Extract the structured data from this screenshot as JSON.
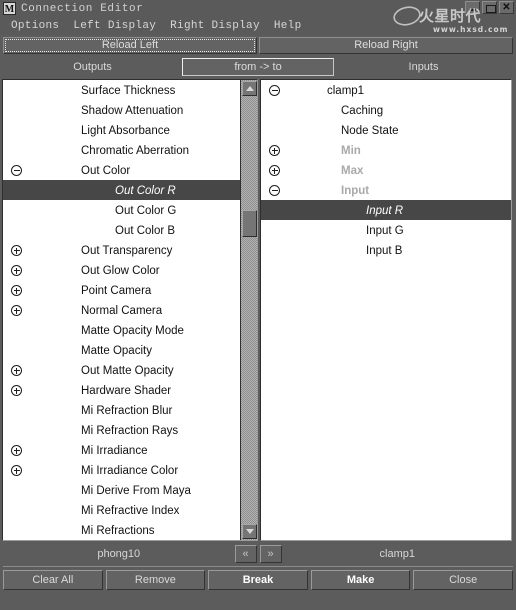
{
  "window": {
    "title": "Connection Editor",
    "icon": "maya-m-icon",
    "controls": {
      "minimize": "minimize-icon",
      "maximize": "maximize-icon",
      "close": "✕"
    }
  },
  "watermark": {
    "url_text": "www.hxsd.com",
    "brand": "火星时代"
  },
  "menubar": {
    "items": [
      {
        "label": "Options"
      },
      {
        "label": "Left Display"
      },
      {
        "label": "Right Display"
      },
      {
        "label": "Help"
      }
    ]
  },
  "reload": {
    "left_label": "Reload Left",
    "right_label": "Reload Right"
  },
  "tabs": {
    "outputs_label": "Outputs",
    "middle_label": "from -> to",
    "inputs_label": "Inputs"
  },
  "left_panel": {
    "node_name": "phong10",
    "rows": [
      {
        "label": "Surface Thickness",
        "indent": 0,
        "toggle": "none",
        "state": "normal"
      },
      {
        "label": "Shadow Attenuation",
        "indent": 0,
        "toggle": "none",
        "state": "normal"
      },
      {
        "label": "Light Absorbance",
        "indent": 0,
        "toggle": "none",
        "state": "normal"
      },
      {
        "label": "Chromatic Aberration",
        "indent": 0,
        "toggle": "none",
        "state": "normal"
      },
      {
        "label": "Out Color",
        "indent": 0,
        "toggle": "minus",
        "state": "normal"
      },
      {
        "label": "Out Color R",
        "indent": 1,
        "toggle": "none",
        "state": "selected"
      },
      {
        "label": "Out Color G",
        "indent": 1,
        "toggle": "none",
        "state": "normal"
      },
      {
        "label": "Out Color B",
        "indent": 1,
        "toggle": "none",
        "state": "normal"
      },
      {
        "label": "Out Transparency",
        "indent": 0,
        "toggle": "plus",
        "state": "normal"
      },
      {
        "label": "Out Glow Color",
        "indent": 0,
        "toggle": "plus",
        "state": "normal"
      },
      {
        "label": "Point Camera",
        "indent": 0,
        "toggle": "plus",
        "state": "normal"
      },
      {
        "label": "Normal Camera",
        "indent": 0,
        "toggle": "plus",
        "state": "normal"
      },
      {
        "label": "Matte Opacity Mode",
        "indent": 0,
        "toggle": "none",
        "state": "normal"
      },
      {
        "label": "Matte Opacity",
        "indent": 0,
        "toggle": "none",
        "state": "normal"
      },
      {
        "label": "Out Matte Opacity",
        "indent": 0,
        "toggle": "plus",
        "state": "normal"
      },
      {
        "label": "Hardware Shader",
        "indent": 0,
        "toggle": "plus",
        "state": "normal"
      },
      {
        "label": "Mi Refraction Blur",
        "indent": 0,
        "toggle": "none",
        "state": "normal"
      },
      {
        "label": "Mi Refraction Rays",
        "indent": 0,
        "toggle": "none",
        "state": "normal"
      },
      {
        "label": "Mi Irradiance",
        "indent": 0,
        "toggle": "plus",
        "state": "normal"
      },
      {
        "label": "Mi Irradiance Color",
        "indent": 0,
        "toggle": "plus",
        "state": "normal"
      },
      {
        "label": "Mi Derive From Maya",
        "indent": 0,
        "toggle": "none",
        "state": "normal"
      },
      {
        "label": "Mi Refractive Index",
        "indent": 0,
        "toggle": "none",
        "state": "normal"
      },
      {
        "label": "Mi Refractions",
        "indent": 0,
        "toggle": "none",
        "state": "normal"
      }
    ]
  },
  "right_panel": {
    "node_name": "clamp1",
    "rows": [
      {
        "label": "clamp1",
        "indent": 0,
        "toggle": "minus",
        "state": "normal"
      },
      {
        "label": "Caching",
        "indent": 1,
        "toggle": "none",
        "state": "normal"
      },
      {
        "label": "Node State",
        "indent": 1,
        "toggle": "none",
        "state": "normal"
      },
      {
        "label": "Min",
        "indent": 1,
        "toggle": "plus",
        "state": "dim"
      },
      {
        "label": "Max",
        "indent": 1,
        "toggle": "plus",
        "state": "dim"
      },
      {
        "label": "Input",
        "indent": 1,
        "toggle": "minus",
        "state": "dim"
      },
      {
        "label": "Input R",
        "indent": 2,
        "toggle": "none",
        "state": "selected"
      },
      {
        "label": "Input G",
        "indent": 2,
        "toggle": "none",
        "state": "normal"
      },
      {
        "label": "Input B",
        "indent": 2,
        "toggle": "none",
        "state": "normal"
      }
    ]
  },
  "nav": {
    "prev_label": "«",
    "next_label": "»"
  },
  "bottom_buttons": [
    {
      "label": "Clear All",
      "emphasis": "normal"
    },
    {
      "label": "Remove",
      "emphasis": "normal"
    },
    {
      "label": "Break",
      "emphasis": "strong"
    },
    {
      "label": "Make",
      "emphasis": "strong"
    },
    {
      "label": "Close",
      "emphasis": "normal"
    }
  ],
  "colors": {
    "chrome": "#5c5c5c",
    "panel_bg": "#ffffff",
    "selection": "#474747",
    "text": "#d9d9d9"
  }
}
